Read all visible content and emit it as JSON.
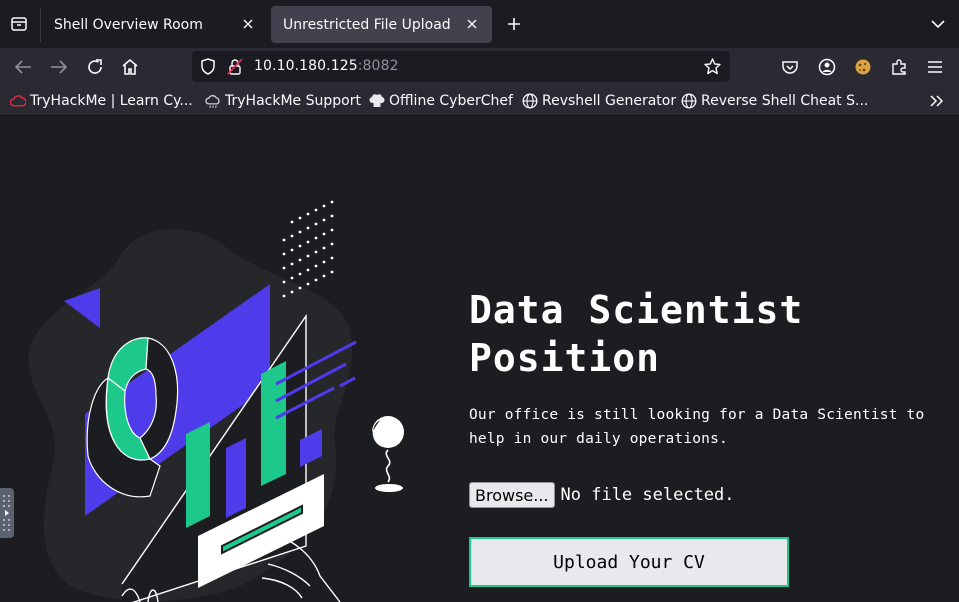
{
  "browser": {
    "tabs": [
      {
        "label": "Shell Overview Room",
        "active": false
      },
      {
        "label": "Unrestricted File Upload",
        "active": true
      }
    ],
    "url": {
      "host": "10.10.180.125",
      "port": ":8082"
    },
    "bookmarks": [
      {
        "label": "TryHackMe | Learn Cy...",
        "icon": "tryhackme-icon"
      },
      {
        "label": "TryHackMe Support",
        "icon": "support-cloud-icon"
      },
      {
        "label": "Offline CyberChef",
        "icon": "chef-hat-icon"
      },
      {
        "label": "Revshell Generator",
        "icon": "globe-icon"
      },
      {
        "label": "Reverse Shell Cheat S...",
        "icon": "globe-icon"
      }
    ]
  },
  "page": {
    "title_line1": "Data Scientist",
    "title_line2": "Position",
    "description": "Our office is still looking for a Data Scientist to help in our daily operations.",
    "browse_label": "Browse...",
    "file_status": "No file selected.",
    "upload_label": "Upload Your CV"
  },
  "colors": {
    "accent_green": "#1cc88a",
    "accent_purple": "#4e3bea",
    "page_bg": "#1c1d20",
    "toolbar_bg": "#2b2a33"
  }
}
